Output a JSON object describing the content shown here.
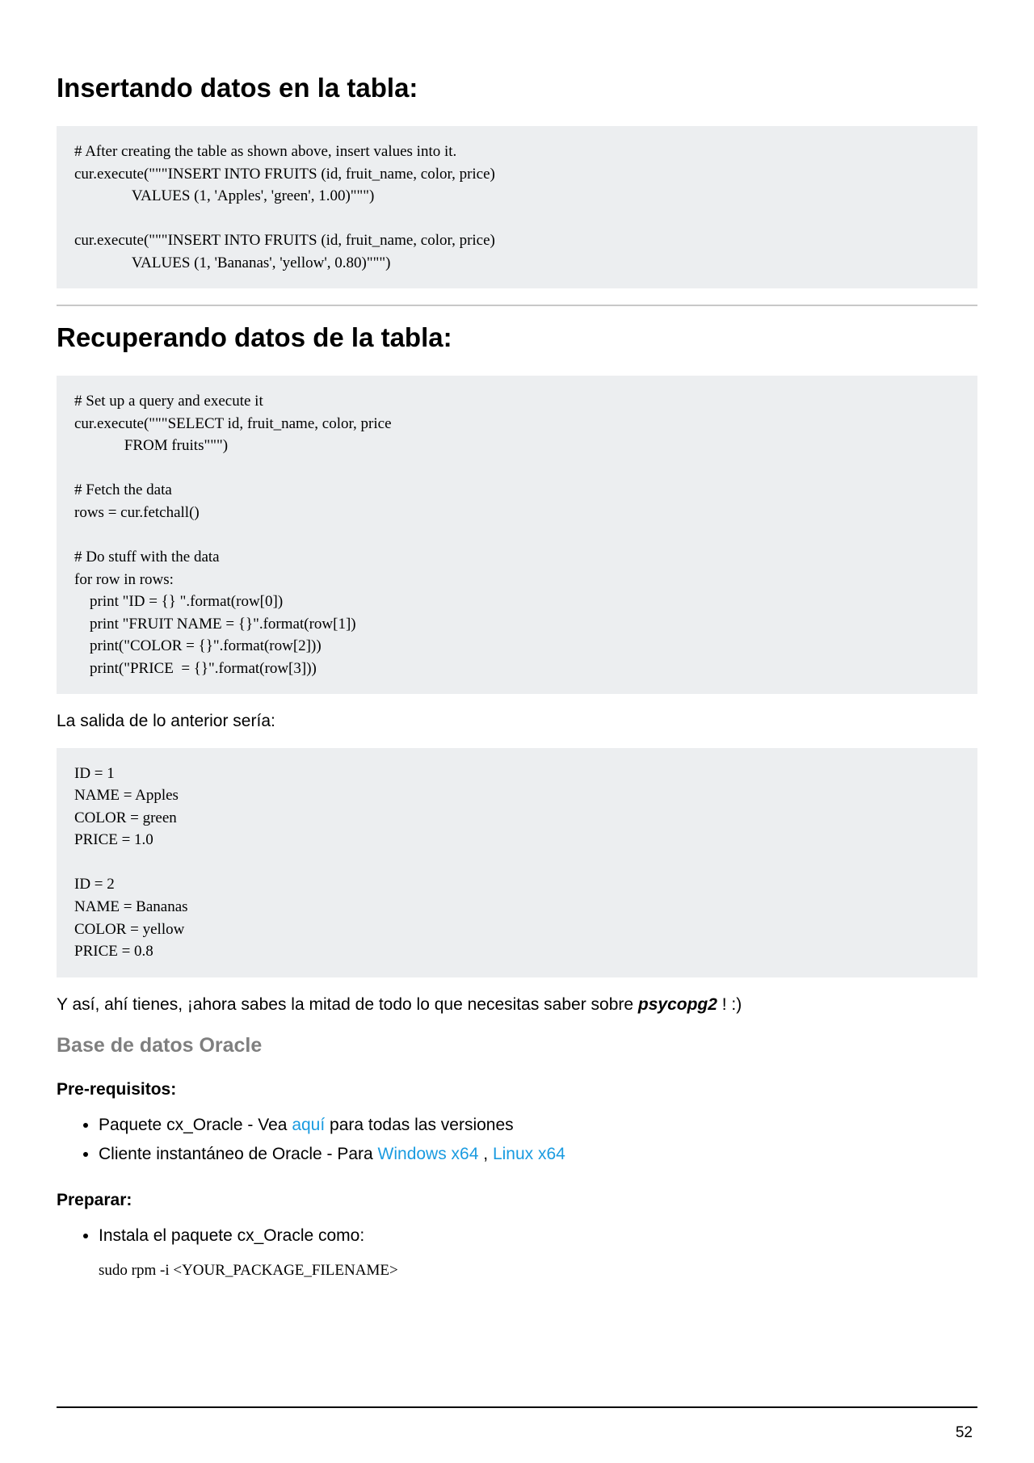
{
  "headings": {
    "h1_insert": "Insertando datos en la tabla:",
    "h1_retrieve": "Recuperando datos de la tabla:",
    "oracle": "Base de datos Oracle",
    "prereq": "Pre-requisitos:",
    "setup": "Preparar:"
  },
  "code": {
    "insert": "# After creating the table as shown above, insert values into it.\ncur.execute(\"\"\"INSERT INTO FRUITS (id, fruit_name, color, price)\n               VALUES (1, 'Apples', 'green', 1.00)\"\"\")\n\ncur.execute(\"\"\"INSERT INTO FRUITS (id, fruit_name, color, price)\n               VALUES (1, 'Bananas', 'yellow', 0.80)\"\"\")",
    "select": "# Set up a query and execute it\ncur.execute(\"\"\"SELECT id, fruit_name, color, price\n             FROM fruits\"\"\")\n\n# Fetch the data\nrows = cur.fetchall()\n\n# Do stuff with the data\nfor row in rows:\n    print \"ID = {} \".format(row[0])\n    print \"FRUIT NAME = {}\".format(row[1])\n    print(\"COLOR = {}\".format(row[2]))\n    print(\"PRICE  = {}\".format(row[3]))",
    "output": "ID = 1\nNAME = Apples\nCOLOR = green\nPRICE = 1.0\n\nID = 2\nNAME = Bananas\nCOLOR = yellow\nPRICE = 0.8",
    "rpm": "sudo rpm -i <YOUR_PACKAGE_FILENAME>"
  },
  "text": {
    "output_label": "La salida de lo anterior sería:",
    "psycopg_line_before": "Y así, ahí tienes, ¡ahora sabes la mitad de todo lo que necesitas saber sobre ",
    "psycopg": "psycopg2",
    "psycopg_line_after": " ! :)",
    "li1_before": "Paquete cx_Oracle - Vea ",
    "li1_link": "aquí",
    "li1_after": " para todas las versiones",
    "li2_before": "Cliente instantáneo de Oracle - Para ",
    "li2_link1": "Windows x64",
    "li2_mid": " , ",
    "li2_link2": "Linux x64",
    "li3": "Instala el paquete cx_Oracle como:"
  },
  "page_number": "52"
}
